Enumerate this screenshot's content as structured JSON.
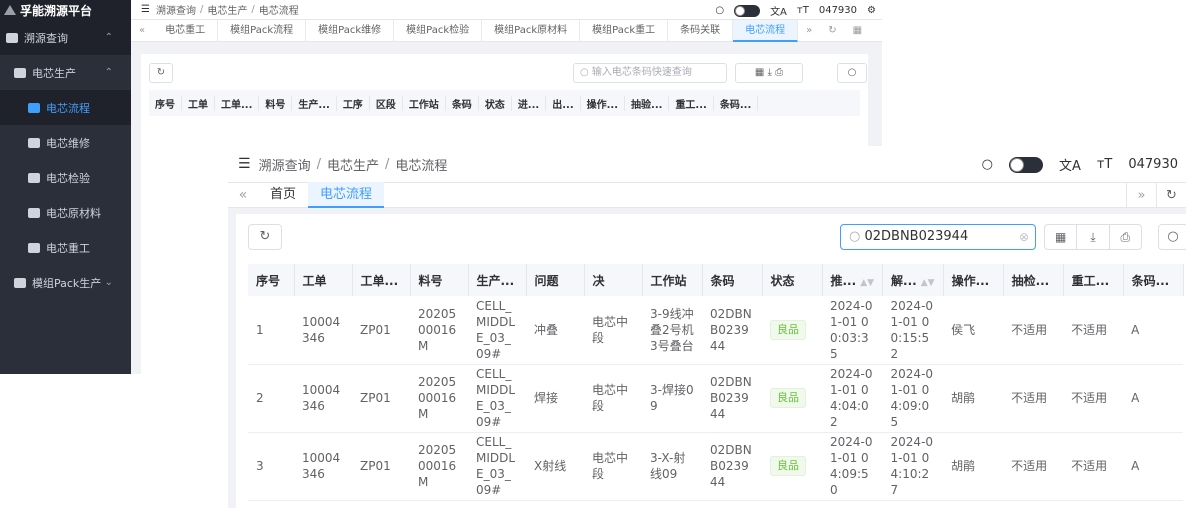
{
  "brand": "孚能溯源平台",
  "sidebar": {
    "items": [
      {
        "label": "溯源查询"
      },
      {
        "label": "电芯生产"
      },
      {
        "label": "电芯流程"
      },
      {
        "label": "电芯维修"
      },
      {
        "label": "电芯检验"
      },
      {
        "label": "电芯原材料"
      },
      {
        "label": "电芯重工"
      },
      {
        "label": "模组Pack生产"
      }
    ]
  },
  "header": {
    "breadcrumb": [
      "溯源查询",
      "电芯生产",
      "电芯流程"
    ],
    "user": "047930"
  },
  "back_tabs": [
    "电芯重工",
    "模组Pack流程",
    "模组Pack维修",
    "模组Pack检验",
    "模组Pack原材料",
    "模组Pack重工",
    "条码关联",
    "电芯流程"
  ],
  "back_search_placeholder": "输入电芯条码快速查询",
  "back_columns": [
    "序号",
    "工单",
    "工单...",
    "料号",
    "生产...",
    "工序",
    "区段",
    "工作站",
    "条码",
    "状态",
    "进...",
    "出...",
    "操作...",
    "抽验...",
    "重工...",
    "条码..."
  ],
  "front_tabs": [
    "首页",
    "电芯流程"
  ],
  "search": {
    "value": "02DBNB023944"
  },
  "table": {
    "columns": [
      "序号",
      "工单",
      "工单...",
      "料号",
      "生产...",
      "问题",
      "决",
      "工作站",
      "条码",
      "状态",
      "推...",
      "解...",
      "操作...",
      "抽检...",
      "重工...",
      "条码..."
    ],
    "rows": [
      {
        "seq": "1",
        "order": "10004346",
        "order2": "ZP01",
        "material": "2020500016M",
        "prod": "CELL_MIDDLE_03_09#",
        "issue": "冲叠",
        "decision": "电芯中段",
        "station": "3-9线冲叠2号机3号叠台",
        "barcode": "02DBNB023944",
        "status": "良品",
        "push": "2024-01-01 00:03:35",
        "resolve": "2024-01-01 00:15:52",
        "operator": "侯飞",
        "sample": "不适用",
        "rework": "不适用",
        "code": "A"
      },
      {
        "seq": "2",
        "order": "10004346",
        "order2": "ZP01",
        "material": "2020500016M",
        "prod": "CELL_MIDDLE_03_09#",
        "issue": "焊接",
        "decision": "电芯中段",
        "station": "3-焊接09",
        "barcode": "02DBNB023944",
        "status": "良品",
        "push": "2024-01-01 04:04:02",
        "resolve": "2024-01-01 04:09:05",
        "operator": "胡鹃",
        "sample": "不适用",
        "rework": "不适用",
        "code": "A"
      },
      {
        "seq": "3",
        "order": "10004346",
        "order2": "ZP01",
        "material": "2020500016M",
        "prod": "CELL_MIDDLE_03_09#",
        "issue": "X射线",
        "decision": "电芯中段",
        "station": "3-X-射线09",
        "barcode": "02DBNB023944",
        "status": "良品",
        "push": "2024-01-01 04:09:50",
        "resolve": "2024-01-01 04:10:27",
        "operator": "胡鹃",
        "sample": "不适用",
        "rework": "不适用",
        "code": "A"
      }
    ]
  }
}
